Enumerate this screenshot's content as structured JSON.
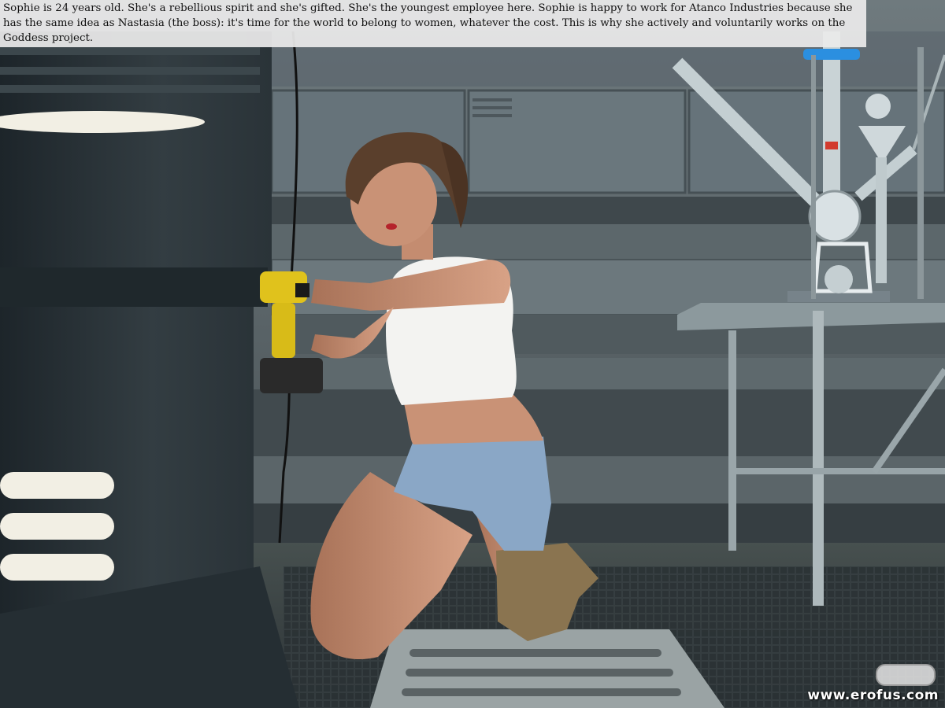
{
  "caption": {
    "text": "Sophie is 24 years old. She's a rebellious spirit and she's gifted. She's the youngest employee here. Sophie is happy to work for Atanco Industries because she has the same idea as Nastasia (the boss): it's time for the world to belong to women, whatever the cost. This is why she actively and voluntarily works on the Goddess project."
  },
  "watermark": {
    "text": "www.erofus.com"
  },
  "colors": {
    "wall": "#5d686c",
    "floor": "#3a4246",
    "machine": "#283136",
    "light_strip": "#f2efe4",
    "drill": "#e0c21c",
    "top": "#f3f3f1",
    "shorts": "#8aa7c6",
    "skin": "#c99276",
    "hair": "#5a3f2c",
    "glass": "#c8d2d6",
    "valve": "#2b8fe0"
  }
}
